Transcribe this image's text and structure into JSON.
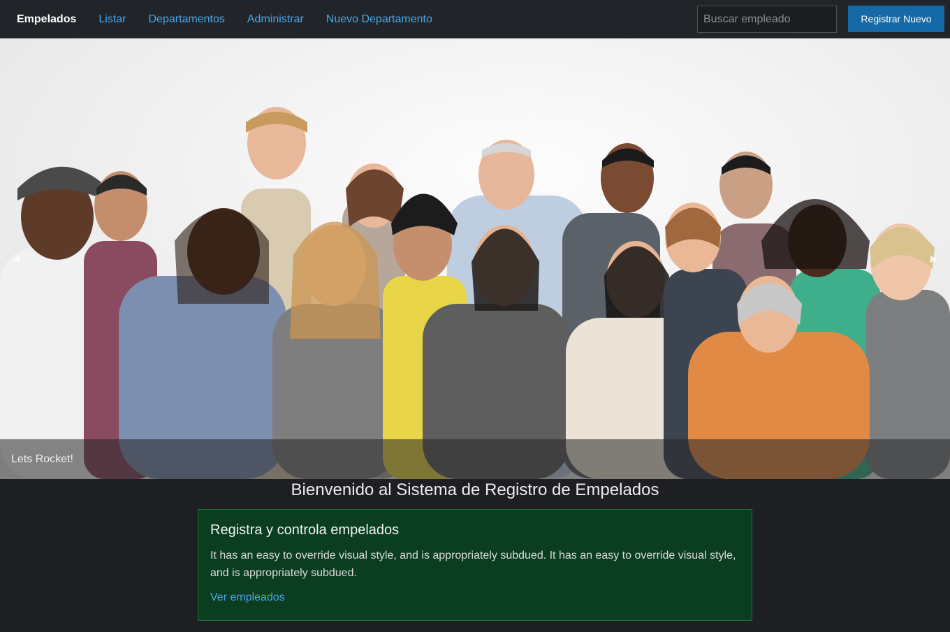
{
  "navbar": {
    "brand": "Empelados",
    "links": [
      "Listar",
      "Departamentos",
      "Administrar",
      "Nuevo Departamento"
    ],
    "search_placeholder": "Buscar empleado",
    "register_label": "Registrar Nuevo"
  },
  "carousel": {
    "caption": "Lets Rocket!",
    "prev_icon": "chevron-left-icon",
    "next_icon": "chevron-right-icon",
    "prev_glyph": "◀",
    "next_glyph": "▶"
  },
  "welcome": {
    "title": "Bienvenido al Sistema de Registro de Empelados"
  },
  "card": {
    "title": "Registra y controla empelados",
    "text": "It has an easy to override visual style, and is appropriately subdued. It has an easy to override visual style, and is appropriately subdued.",
    "link": "Ver empleados"
  },
  "colors": {
    "navbar_bg": "#212529",
    "link": "#4aa6e8",
    "primary_button": "#1469a6",
    "card_bg": "#0b3d21",
    "page_bg": "#1e1f22"
  }
}
